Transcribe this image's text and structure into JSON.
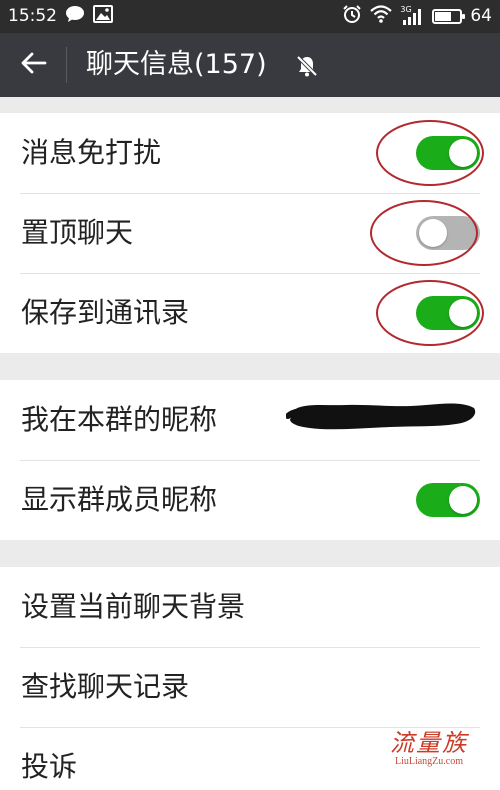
{
  "status_bar": {
    "time": "15:52",
    "network": "3G",
    "battery": "64",
    "battery_level_percent": 64,
    "icons": [
      "chat-bubble-icon",
      "image-icon",
      "alarm-icon",
      "wifi-icon",
      "signal-icon",
      "battery-icon"
    ]
  },
  "header": {
    "title": "聊天信息(157)",
    "back_icon": "back-arrow-icon",
    "muted_icon": "mute-bell-icon",
    "background": "#393a3f"
  },
  "settings": {
    "group1": [
      {
        "label": "消息免打扰",
        "switch": true
      },
      {
        "label": "置顶聊天",
        "switch": false
      },
      {
        "label": "保存到通讯录",
        "switch": true
      }
    ],
    "group2": [
      {
        "label": "我在本群的昵称",
        "value_redacted": true
      },
      {
        "label": "显示群成员昵称",
        "switch": true
      }
    ],
    "group3": [
      {
        "label": "设置当前聊天背景"
      },
      {
        "label": "查找聊天记录"
      },
      {
        "label": "投诉"
      }
    ]
  },
  "colors": {
    "switch_on": "#1aad19",
    "switch_off": "#b4b4b4",
    "annotation_circle": "#b22a2f",
    "page_background": "#ebebeb"
  },
  "watermark": {
    "logo_text": "流量族",
    "url": "LiuLiangZu.com"
  }
}
